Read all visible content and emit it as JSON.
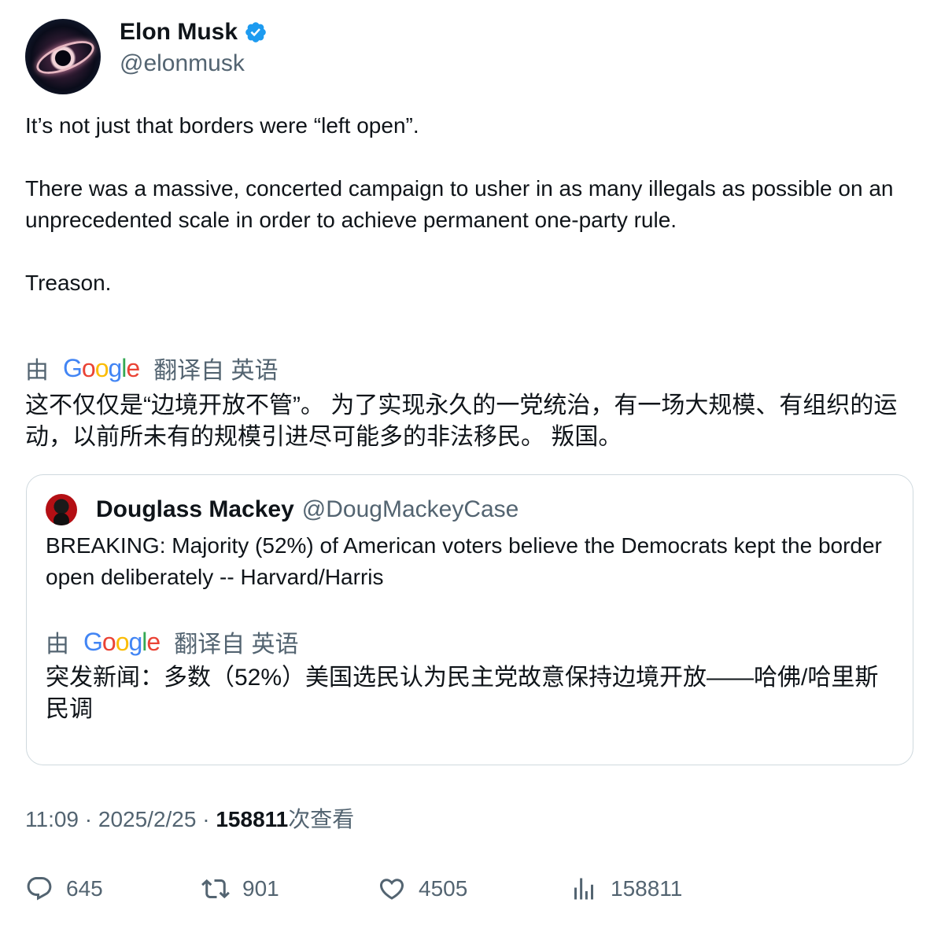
{
  "author": {
    "name": "Elon Musk",
    "handle": "@elonmusk",
    "verified_color": "#1d9bf0"
  },
  "tweet": {
    "paragraphs": [
      "It’s not just that borders were “left open”.",
      "There was a massive, concerted campaign to usher in as many illegals as possible on an unprecedented scale in order to achieve permanent one-party rule.",
      "Treason."
    ],
    "translation": {
      "by": "由",
      "provider": "Google",
      "from_label": "翻译自 英语",
      "text": "这不仅仅是“边境开放不管”。 为了实现永久的一党统治，有一场大规模、有组织的运动，以前所未有的规模引进尽可能多的非法移民。 叛国。"
    }
  },
  "quote": {
    "name": "Douglass Mackey",
    "handle": "@DougMackeyCase",
    "text": "BREAKING: Majority (52%) of American voters believe the Democrats kept the border open deliberately -- Harvard/Harris",
    "translation": {
      "by": "由",
      "provider": "Google",
      "from_label": "翻译自 英语",
      "text": "突发新闻：多数（52%）美国选民认为民主党故意保持边境开放——哈佛/哈里斯民调"
    }
  },
  "meta": {
    "time": "11:09",
    "sep": " · ",
    "date": "2025/2/25",
    "views_count": "158811",
    "views_label": "次查看"
  },
  "actions": {
    "replies": "645",
    "retweets": "901",
    "likes": "4505",
    "views": "158811"
  },
  "colors": {
    "text": "#0f1419",
    "secondary": "#536471",
    "border": "#cfd9de",
    "google_blue": "#4285F4",
    "google_red": "#EA4335",
    "google_yellow": "#FBBC05",
    "google_green": "#34A853"
  }
}
